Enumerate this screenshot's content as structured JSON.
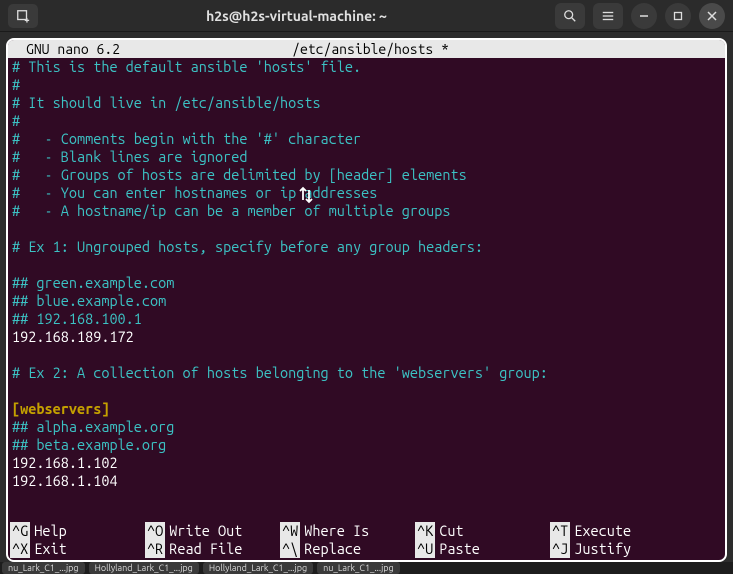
{
  "titlebar": {
    "title": "h2s@h2s-virtual-machine: ~"
  },
  "nano": {
    "program": "GNU nano 6.2",
    "filename": "/etc/ansible/hosts *"
  },
  "lines": {
    "l1": "# This is the default ansible 'hosts' file.",
    "l2": "#",
    "l3": "# It should live in /etc/ansible/hosts",
    "l4": "#",
    "l5": "#   - Comments begin with the '#' character",
    "l6": "#   - Blank lines are ignored",
    "l7": "#   - Groups of hosts are delimited by [header] elements",
    "l8": "#   - You can enter hostnames or ip addresses",
    "l9": "#   - A hostname/ip can be a member of multiple groups",
    "l10": "",
    "l11": "# Ex 1: Ungrouped hosts, specify before any group headers:",
    "l12": "",
    "l13": "## green.example.com",
    "l14": "## blue.example.com",
    "l15": "## 192.168.100.1",
    "l16": "192.168.189.172",
    "l17": "",
    "l18": "# Ex 2: A collection of hosts belonging to the 'webservers' group:",
    "l19": "",
    "l20": "[webservers]",
    "l21": "## alpha.example.org",
    "l22": "## beta.example.org",
    "l23": "192.168.1.102",
    "l24": "192.168.1.104"
  },
  "shortcuts": {
    "r1": [
      {
        "k": "^G",
        "t": "Help"
      },
      {
        "k": "^O",
        "t": "Write Out"
      },
      {
        "k": "^W",
        "t": "Where Is"
      },
      {
        "k": "^K",
        "t": "Cut"
      },
      {
        "k": "^T",
        "t": "Execute"
      }
    ],
    "r2": [
      {
        "k": "^X",
        "t": "Exit"
      },
      {
        "k": "^R",
        "t": "Read File"
      },
      {
        "k": "^\\",
        "t": "Replace"
      },
      {
        "k": "^U",
        "t": "Paste"
      },
      {
        "k": "^J",
        "t": "Justify"
      }
    ]
  },
  "taskbar": {
    "t1": "nu_Lark_C1_...jpg",
    "t2": "Hollyland_Lark_C1_...jpg",
    "t3": "Hollyland_Lark_C1_...jpg",
    "t4": "nu_Lark_C1_...jpg"
  }
}
